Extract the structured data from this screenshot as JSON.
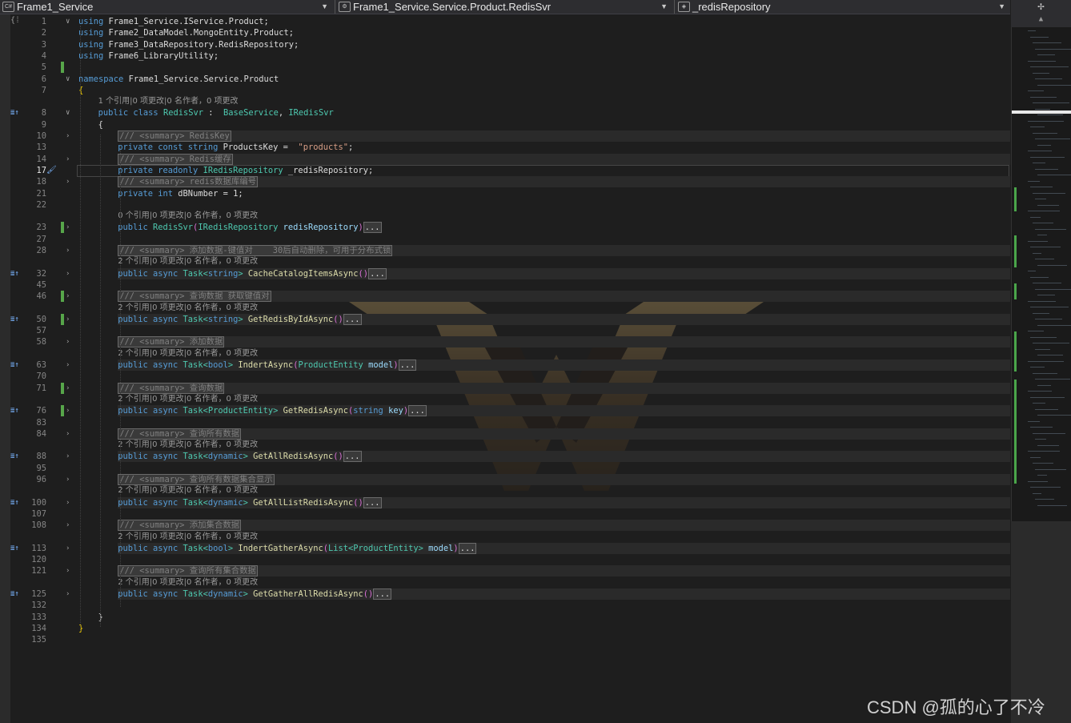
{
  "navbar": {
    "project": "Frame1_Service",
    "type_scope": "Frame1_Service.Service.Product.RedisSvr",
    "member": "_redisRepository"
  },
  "watermark": "CSDN @孤的心了不冷",
  "colors": {
    "keyword": "#569cd6",
    "type": "#4ec9b0",
    "string": "#d69d85",
    "comment": "#57a64a",
    "method": "#dcdcaa",
    "param": "#9cdcfe",
    "change_bar": "#57a64a"
  },
  "lines": [
    {
      "n": "1",
      "tokens": [
        [
          "k",
          "using"
        ],
        [
          "",
          "Frame1_Service.IService.Product;"
        ]
      ],
      "fold": "∨"
    },
    {
      "n": "2",
      "tokens": [
        [
          "k",
          "using"
        ],
        [
          "",
          "Frame2_DataModel.MongoEntity.Product;"
        ]
      ]
    },
    {
      "n": "3",
      "tokens": [
        [
          "k",
          "using"
        ],
        [
          "",
          "Frame3_DataRepository.RedisRepository;"
        ]
      ]
    },
    {
      "n": "4",
      "tokens": [
        [
          "k",
          "using"
        ],
        [
          "",
          "Frame6_LibraryUtility;"
        ]
      ]
    },
    {
      "n": "5",
      "tokens": [],
      "chg": true
    },
    {
      "n": "6",
      "tokens": [
        [
          "k",
          "namespace"
        ],
        [
          "",
          "Frame1_Service.Service.Product"
        ]
      ],
      "fold": "∨"
    },
    {
      "n": "7",
      "tokens": [
        [
          "brace",
          "{"
        ]
      ]
    },
    {
      "lens": "1 个引用|0 项更改|0 名作者，0 项更改",
      "indent": 2
    },
    {
      "n": "8",
      "indent": 2,
      "tokens": [
        [
          "k",
          "public"
        ],
        [
          "k",
          "class"
        ],
        [
          "t",
          "RedisSvr"
        ],
        [
          "",
          " : "
        ],
        [
          "t",
          "BaseService"
        ],
        [
          "",
          ","
        ],
        [
          "t",
          "IRedisSvr"
        ]
      ],
      "fold": "∨",
      "icon": "≣↑"
    },
    {
      "n": "9",
      "indent": 2,
      "tokens": [
        [
          "",
          "{"
        ]
      ]
    },
    {
      "n": "10",
      "indent": 4,
      "hl": true,
      "tokens": [
        [
          "cm boxed",
          "/// <summary> RedisKey"
        ]
      ],
      "fold": "›"
    },
    {
      "n": "13",
      "indent": 4,
      "tokens": [
        [
          "k",
          "private"
        ],
        [
          "k",
          "const"
        ],
        [
          "k",
          "string"
        ],
        [
          "",
          "ProductsKey = "
        ],
        [
          "s",
          "\"products\""
        ],
        [
          "",
          ";"
        ]
      ]
    },
    {
      "n": "14",
      "indent": 4,
      "hl": true,
      "tokens": [
        [
          "cm boxed",
          "/// <summary> Redis缓存"
        ]
      ],
      "fold": "›"
    },
    {
      "n": "17",
      "indent": 4,
      "cur": true,
      "tokens": [
        [
          "k",
          "private"
        ],
        [
          "k",
          "readonly"
        ],
        [
          "t",
          "IRedisRepository"
        ],
        [
          "",
          "_redisRepository;"
        ]
      ],
      "icon": "🖌"
    },
    {
      "n": "18",
      "indent": 4,
      "hl": true,
      "tokens": [
        [
          "cm boxed",
          "/// <summary> redis数据库编号"
        ]
      ],
      "fold": "›"
    },
    {
      "n": "21",
      "indent": 4,
      "tokens": [
        [
          "k",
          "private"
        ],
        [
          "k",
          "int"
        ],
        [
          "",
          "dBNumber = 1;"
        ]
      ]
    },
    {
      "n": "22",
      "tokens": []
    },
    {
      "lens": "0 个引用|0 项更改|0 名作者，0 项更改",
      "indent": 4
    },
    {
      "n": "23",
      "indent": 4,
      "chg": true,
      "tokens": [
        [
          "k",
          "public"
        ],
        [
          "t",
          "RedisSvr"
        ],
        [
          "paren",
          "("
        ],
        [
          "t",
          "IRedisRepository"
        ],
        [
          "p",
          "redisRepository"
        ],
        [
          "paren",
          ")"
        ],
        [
          "boxed",
          "..."
        ]
      ],
      "fold": "›"
    },
    {
      "n": "27",
      "tokens": []
    },
    {
      "n": "28",
      "indent": 4,
      "hl": true,
      "tokens": [
        [
          "cm boxed",
          "/// <summary> 添加数据-键值对    30后自动删除，可用于分布式锁"
        ]
      ],
      "fold": "›"
    },
    {
      "lens": "2 个引用|0 项更改|0 名作者，0 项更改",
      "indent": 4
    },
    {
      "n": "32",
      "indent": 4,
      "hl": true,
      "tokens": [
        [
          "k",
          "public"
        ],
        [
          "k",
          "async"
        ],
        [
          "t",
          "Task<"
        ],
        [
          "k",
          "string"
        ],
        [
          "t",
          ">"
        ],
        [
          "m",
          "CacheCatalogItemsAsync"
        ],
        [
          "paren",
          "()"
        ],
        [
          "boxed",
          "..."
        ]
      ],
      "fold": "›",
      "icon": "≣↑"
    },
    {
      "n": "45",
      "tokens": []
    },
    {
      "n": "46",
      "indent": 4,
      "chg": true,
      "hl": true,
      "tokens": [
        [
          "cm boxed",
          "/// <summary> 查询数据 获取键值对"
        ]
      ],
      "fold": "›"
    },
    {
      "lens": "2 个引用|0 项更改|0 名作者，0 项更改",
      "indent": 4
    },
    {
      "n": "50",
      "indent": 4,
      "chg": true,
      "hl": true,
      "tokens": [
        [
          "k",
          "public"
        ],
        [
          "k",
          "async"
        ],
        [
          "t",
          "Task<"
        ],
        [
          "k",
          "string"
        ],
        [
          "t",
          ">"
        ],
        [
          "m",
          "GetRedisByIdAsync"
        ],
        [
          "paren",
          "()"
        ],
        [
          "boxed",
          "..."
        ]
      ],
      "fold": "›",
      "icon": "≣↑"
    },
    {
      "n": "57",
      "tokens": []
    },
    {
      "n": "58",
      "indent": 4,
      "hl": true,
      "tokens": [
        [
          "cm boxed",
          "/// <summary> 添加数据"
        ]
      ],
      "fold": "›"
    },
    {
      "lens": "2 个引用|0 项更改|0 名作者，0 项更改",
      "indent": 4
    },
    {
      "n": "63",
      "indent": 4,
      "hl": true,
      "tokens": [
        [
          "k",
          "public"
        ],
        [
          "k",
          "async"
        ],
        [
          "t",
          "Task<"
        ],
        [
          "k",
          "bool"
        ],
        [
          "t",
          ">"
        ],
        [
          "m",
          "IndertAsync"
        ],
        [
          "paren",
          "("
        ],
        [
          "t",
          "ProductEntity"
        ],
        [
          "p",
          "model"
        ],
        [
          "paren",
          ")"
        ],
        [
          "boxed",
          "..."
        ]
      ],
      "fold": "›",
      "icon": "≣↑"
    },
    {
      "n": "70",
      "tokens": []
    },
    {
      "n": "71",
      "indent": 4,
      "chg": true,
      "hl": true,
      "tokens": [
        [
          "cm boxed",
          "/// <summary> 查询数据"
        ]
      ],
      "fold": "›"
    },
    {
      "lens": "2 个引用|0 项更改|0 名作者，0 项更改",
      "indent": 4
    },
    {
      "n": "76",
      "indent": 4,
      "chg": true,
      "hl": true,
      "tokens": [
        [
          "k",
          "public"
        ],
        [
          "k",
          "async"
        ],
        [
          "t",
          "Task<ProductEntity>"
        ],
        [
          "m",
          "GetRedisAsync"
        ],
        [
          "paren",
          "("
        ],
        [
          "k",
          "string"
        ],
        [
          "p",
          "key"
        ],
        [
          "paren",
          ")"
        ],
        [
          "boxed",
          "..."
        ]
      ],
      "fold": "›",
      "icon": "≣↑"
    },
    {
      "n": "83",
      "tokens": []
    },
    {
      "n": "84",
      "indent": 4,
      "hl": true,
      "tokens": [
        [
          "cm boxed",
          "/// <summary> 查询所有数据"
        ]
      ],
      "fold": "›"
    },
    {
      "lens": "2 个引用|0 项更改|0 名作者，0 项更改",
      "indent": 4
    },
    {
      "n": "88",
      "indent": 4,
      "hl": true,
      "tokens": [
        [
          "k",
          "public"
        ],
        [
          "k",
          "async"
        ],
        [
          "t",
          "Task<"
        ],
        [
          "k",
          "dynamic"
        ],
        [
          "t",
          ">"
        ],
        [
          "m",
          "GetAllRedisAsync"
        ],
        [
          "paren",
          "()"
        ],
        [
          "boxed",
          "..."
        ]
      ],
      "fold": "›",
      "icon": "≣↑"
    },
    {
      "n": "95",
      "tokens": []
    },
    {
      "n": "96",
      "indent": 4,
      "hl": true,
      "tokens": [
        [
          "cm boxed",
          "/// <summary> 查询所有数据集合显示"
        ]
      ],
      "fold": "›"
    },
    {
      "lens": "2 个引用|0 项更改|0 名作者，0 项更改",
      "indent": 4
    },
    {
      "n": "100",
      "indent": 4,
      "hl": true,
      "tokens": [
        [
          "k",
          "public"
        ],
        [
          "k",
          "async"
        ],
        [
          "t",
          "Task<"
        ],
        [
          "k",
          "dynamic"
        ],
        [
          "t",
          ">"
        ],
        [
          "m",
          "GetAllListRedisAsync"
        ],
        [
          "paren",
          "()"
        ],
        [
          "boxed",
          "..."
        ]
      ],
      "fold": "›",
      "icon": "≣↑"
    },
    {
      "n": "107",
      "tokens": []
    },
    {
      "n": "108",
      "indent": 4,
      "hl": true,
      "tokens": [
        [
          "cm boxed",
          "/// <summary> 添加集合数据"
        ]
      ],
      "fold": "›"
    },
    {
      "lens": "2 个引用|0 项更改|0 名作者，0 项更改",
      "indent": 4
    },
    {
      "n": "113",
      "indent": 4,
      "hl": true,
      "tokens": [
        [
          "k",
          "public"
        ],
        [
          "k",
          "async"
        ],
        [
          "t",
          "Task<"
        ],
        [
          "k",
          "bool"
        ],
        [
          "t",
          ">"
        ],
        [
          "m",
          "IndertGatherAsync"
        ],
        [
          "paren",
          "("
        ],
        [
          "t",
          "List<ProductEntity>"
        ],
        [
          "p",
          "model"
        ],
        [
          "paren",
          ")"
        ],
        [
          "boxed",
          "..."
        ]
      ],
      "fold": "›",
      "icon": "≣↑"
    },
    {
      "n": "120",
      "tokens": []
    },
    {
      "n": "121",
      "indent": 4,
      "hl": true,
      "tokens": [
        [
          "cm boxed",
          "/// <summary> 查询所有集合数据"
        ]
      ],
      "fold": "›"
    },
    {
      "lens": "2 个引用|0 项更改|0 名作者，0 项更改",
      "indent": 4
    },
    {
      "n": "125",
      "indent": 4,
      "hl": true,
      "tokens": [
        [
          "k",
          "public"
        ],
        [
          "k",
          "async"
        ],
        [
          "t",
          "Task<"
        ],
        [
          "k",
          "dynamic"
        ],
        [
          "t",
          ">"
        ],
        [
          "m",
          "GetGatherAllRedisAsync"
        ],
        [
          "paren",
          "()"
        ],
        [
          "boxed",
          "..."
        ]
      ],
      "fold": "›",
      "icon": "≣↑"
    },
    {
      "n": "132",
      "tokens": []
    },
    {
      "n": "133",
      "indent": 2,
      "tokens": [
        [
          "",
          "}"
        ]
      ]
    },
    {
      "n": "134",
      "tokens": [
        [
          "brace",
          "}"
        ]
      ]
    },
    {
      "n": "135",
      "tokens": []
    }
  ]
}
